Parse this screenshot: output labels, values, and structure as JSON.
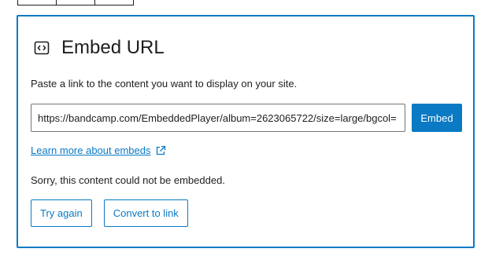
{
  "placeholder": {
    "title": "Embed URL",
    "icon": "embed-icon",
    "instructions": "Paste a link to the content you want to display on your site.",
    "input_value": "https://bandcamp.com/EmbeddedPlayer/album=2623065722/size=large/bgcol=",
    "embed_button": "Embed",
    "learn_more_link": "Learn more about embeds",
    "learn_more_icon": "external-link-icon",
    "error_message": "Sorry, this content could not be embedded.",
    "try_again_button": "Try again",
    "convert_button": "Convert to link"
  },
  "colors": {
    "accent": "#0a7ac4",
    "text": "#1e1e1e",
    "input_border": "#757575"
  }
}
